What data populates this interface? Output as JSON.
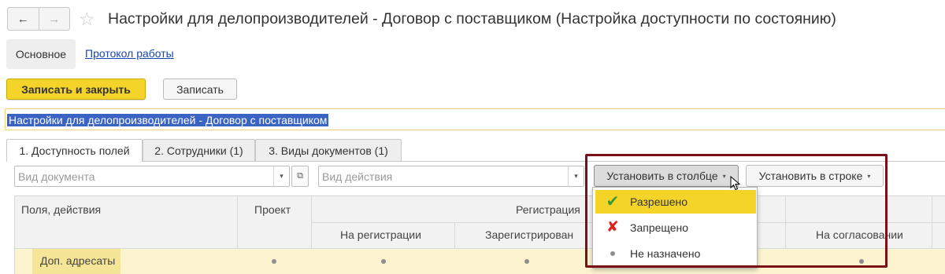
{
  "window": {
    "title": "Настройки для делопроизводителей - Договор с поставщиком (Настройка доступности по состоянию)"
  },
  "nav": {
    "back_glyph": "←",
    "forward_glyph": "→",
    "star_glyph": "☆"
  },
  "sections": {
    "main": "Основное",
    "log_link": "Протокол работы"
  },
  "toolbar": {
    "save_close_label": "Записать и закрыть",
    "save_label": "Записать"
  },
  "description": {
    "value": "Настройки для делопроизводителей - Договор с поставщиком"
  },
  "tabs": [
    {
      "label": "1. Доступность полей",
      "active": true
    },
    {
      "label": "2. Сотрудники (1)",
      "active": false
    },
    {
      "label": "3. Виды документов (1)",
      "active": false
    }
  ],
  "filters": {
    "doc_type_placeholder": "Вид документа",
    "action_type_placeholder": "Вид действия",
    "dropdown_glyph": "▾",
    "open_glyph": "⧉"
  },
  "set_buttons": {
    "column_label": "Установить в столбце",
    "row_label": "Установить в строке",
    "arrow_glyph": "▾"
  },
  "table": {
    "header_fields": "Поля, действия",
    "header_project": "Проект",
    "header_registration": "Регистрация",
    "sub_on_registration": "На регистрации",
    "sub_registered": "Зарегистрирован",
    "sub_on_approval": "На согласовании",
    "rows": [
      {
        "label": "Доп. адресаты"
      }
    ]
  },
  "dropdown_menu": {
    "items": [
      {
        "label": "Разрешено",
        "icon": "check-icon",
        "selected": true
      },
      {
        "label": "Запрещено",
        "icon": "cross-icon",
        "selected": false
      },
      {
        "label": "Не назначено",
        "icon": "dot-icon",
        "selected": false
      }
    ],
    "check_glyph": "✔",
    "cross_glyph": "✘"
  },
  "colors": {
    "accent_yellow": "#f5d42a",
    "highlight_frame": "#7a1016",
    "check_green": "#3e9b2e",
    "cross_red": "#e0201b",
    "selection_blue": "#3a63c4",
    "link_blue": "#1a46b4"
  }
}
